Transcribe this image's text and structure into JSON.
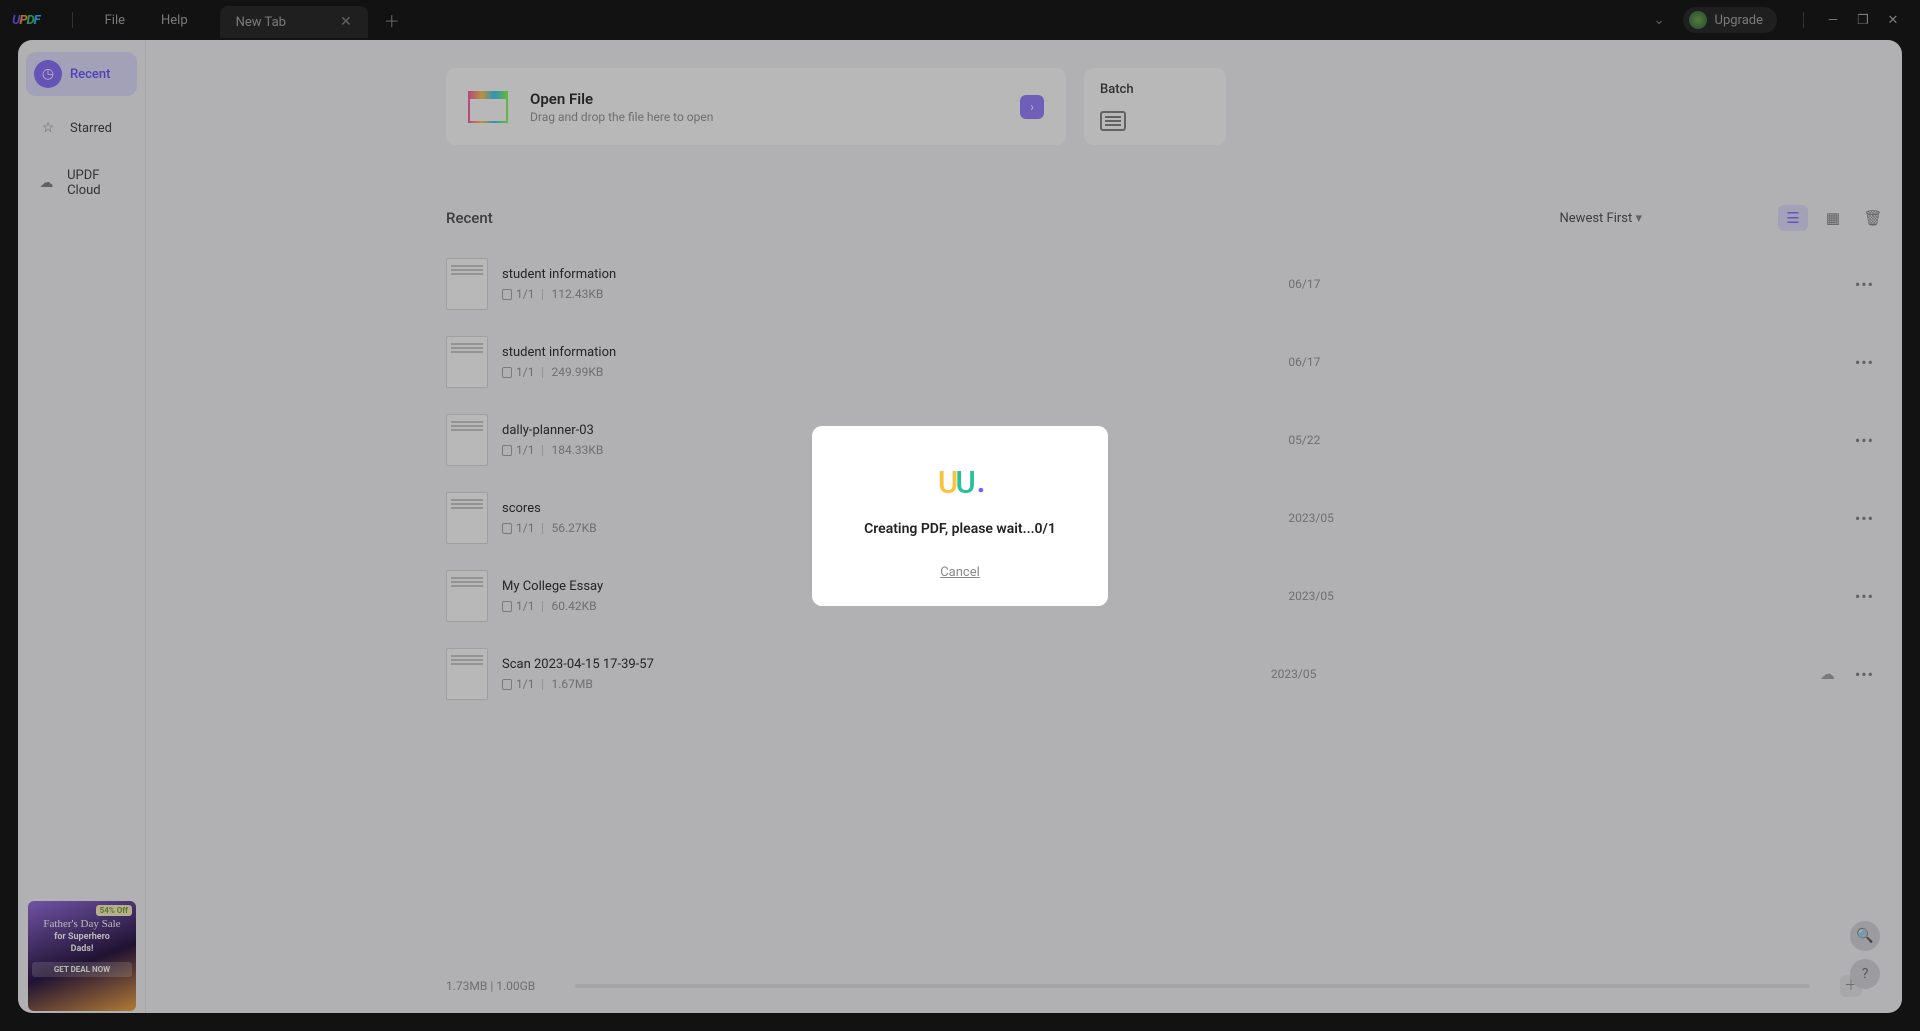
{
  "topbar": {
    "file": "File",
    "help": "Help",
    "tab": "New Tab",
    "upgrade": "Upgrade"
  },
  "sidebar": {
    "recent": "Recent",
    "starred": "Starred",
    "cloud": "UPDF Cloud"
  },
  "open_file": {
    "title": "Open File",
    "subtitle": "Drag and drop the file here to open"
  },
  "batch": {
    "title": "Batch"
  },
  "recent": {
    "title": "Recent",
    "sort": "Newest First",
    "files": [
      {
        "name": "student information",
        "pages": "1/1",
        "size": "112.43KB",
        "date": "06/17",
        "cloud": false
      },
      {
        "name": "student information",
        "pages": "1/1",
        "size": "249.99KB",
        "date": "06/17",
        "cloud": false
      },
      {
        "name": "dally-planner-03",
        "pages": "1/1",
        "size": "184.33KB",
        "date": "05/22",
        "cloud": false
      },
      {
        "name": "scores",
        "pages": "1/1",
        "size": "56.27KB",
        "date": "2023/05",
        "cloud": false
      },
      {
        "name": "My College Essay",
        "pages": "1/1",
        "size": "60.42KB",
        "date": "2023/05",
        "cloud": false
      },
      {
        "name": "Scan 2023-04-15 17-39-57",
        "pages": "1/1",
        "size": "1.67MB",
        "date": "2023/05",
        "cloud": true
      }
    ]
  },
  "storage": {
    "label": "1.73MB | 1.00GB"
  },
  "promo": {
    "off": "54% Off",
    "headline": "Father's Day Sale",
    "sub1": "for Superhero",
    "sub2": "Dads!",
    "cta": "GET DEAL NOW"
  },
  "modal": {
    "message": "Creating PDF, please wait...0/1",
    "cancel": "Cancel"
  }
}
